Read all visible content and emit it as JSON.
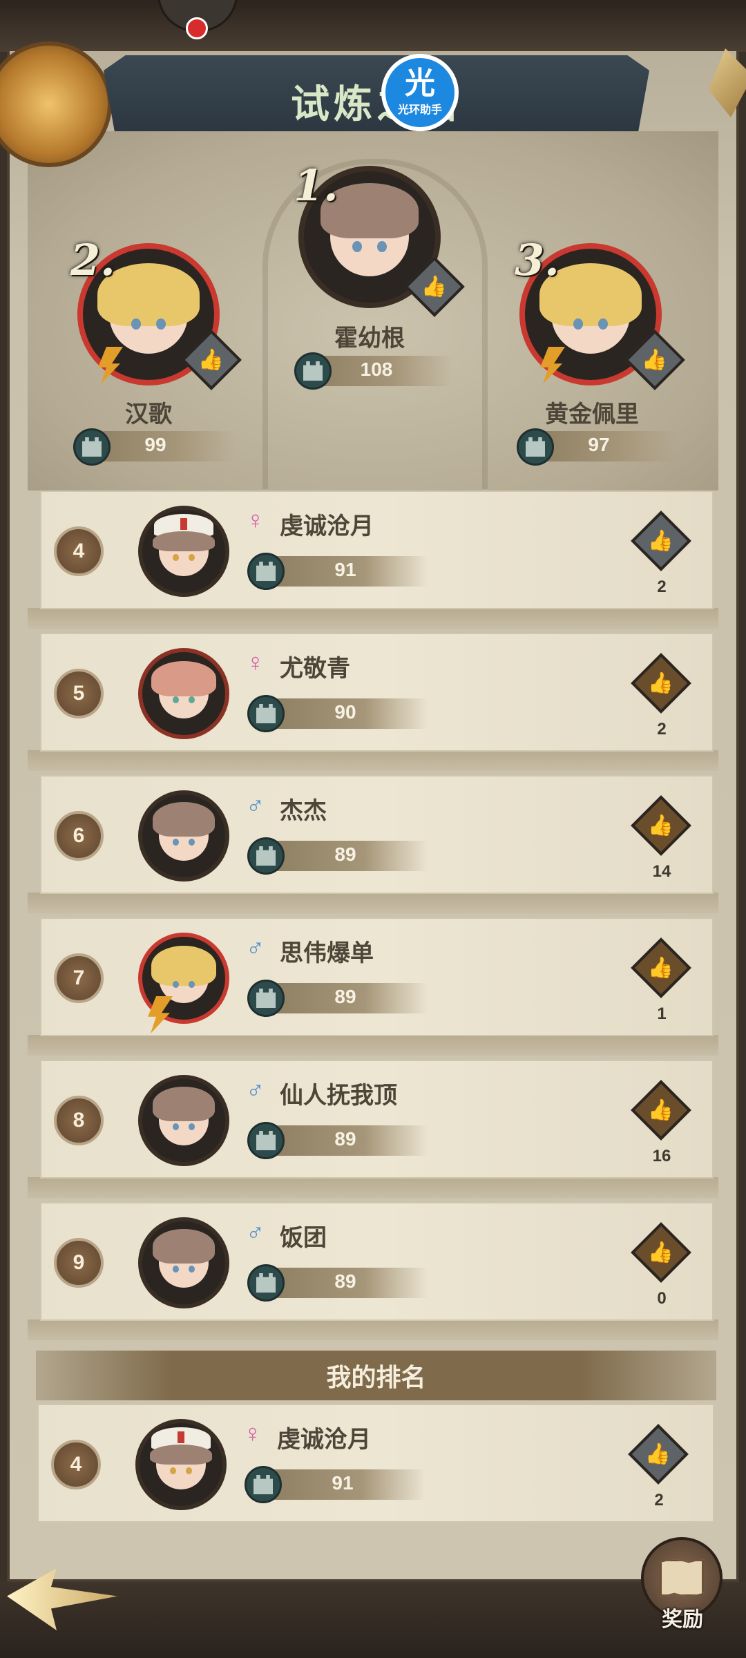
{
  "header": {
    "title": "试炼之塔",
    "logo_big": "光",
    "logo_small": "光环助手"
  },
  "podium": [
    {
      "rank": "1.",
      "name": "霍幼根",
      "score": "108"
    },
    {
      "rank": "2.",
      "name": "汉歌",
      "score": "99"
    },
    {
      "rank": "3.",
      "name": "黄金佩里",
      "score": "97"
    }
  ],
  "rows": [
    {
      "rank": "4",
      "gender": "♀",
      "name": "虔诚沧月",
      "score": "91",
      "likes": "2"
    },
    {
      "rank": "5",
      "gender": "♀",
      "name": "尤敬青",
      "score": "90",
      "likes": "2"
    },
    {
      "rank": "6",
      "gender": "♂",
      "name": "杰杰",
      "score": "89",
      "likes": "14"
    },
    {
      "rank": "7",
      "gender": "♂",
      "name": "思伟爆单",
      "score": "89",
      "likes": "1"
    },
    {
      "rank": "8",
      "gender": "♂",
      "name": "仙人抚我顶",
      "score": "89",
      "likes": "16"
    },
    {
      "rank": "9",
      "gender": "♂",
      "name": "饭团",
      "score": "89",
      "likes": "0"
    }
  ],
  "my_rank": {
    "header": "我的排名",
    "rank": "4",
    "gender": "♀",
    "name": "虔诚沧月",
    "score": "91",
    "likes": "2"
  },
  "footer": {
    "reward_label": "奖励"
  },
  "icons": {
    "like": "thumbs-up-icon",
    "tower": "tower-icon",
    "back": "back-arrow-icon",
    "reward": "map-icon"
  },
  "colors": {
    "accent_gold": "#f4c980",
    "female": "#d661a6",
    "male": "#4d8ed0",
    "title": "#d8e8c6"
  }
}
